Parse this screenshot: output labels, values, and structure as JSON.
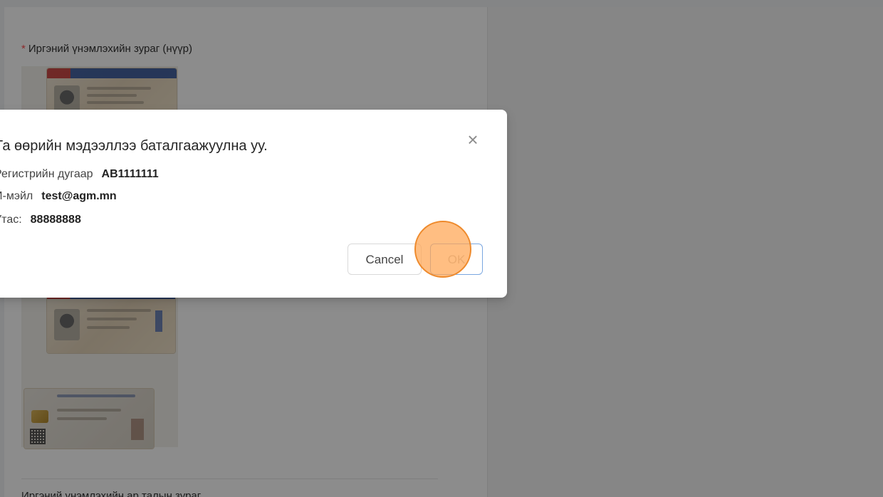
{
  "form": {
    "required_marker": "*",
    "front_id_label": "Иргэний үнэмлэхийн зураг (нүүр)",
    "next_label": "Иргэний үнэмлэхийн ар талын зураг"
  },
  "modal": {
    "title": "Та өөрийн мэдээллээ баталгаажуулна уу.",
    "fields": [
      {
        "label": "Регистрийн дугаар",
        "value": "АВ1111111"
      },
      {
        "label": "И-мэйл",
        "value": "test@agm.mn"
      },
      {
        "label": "Утас:",
        "value": "88888888"
      }
    ],
    "cancel_label": "Cancel",
    "ok_label": "OK",
    "close_icon": "×"
  },
  "colors": {
    "required": "#ff4d4f",
    "ok_border": "#7aa7e0",
    "click_indicator": "#ffa552"
  }
}
